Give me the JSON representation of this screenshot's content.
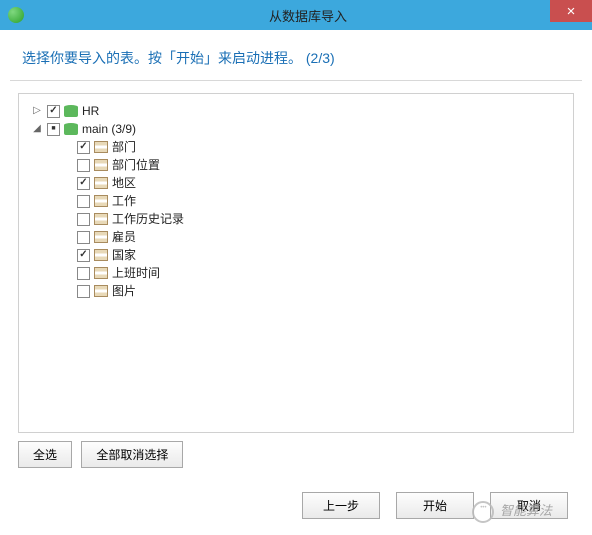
{
  "window": {
    "title": "从数据库导入",
    "close_char": "×"
  },
  "header": {
    "text": "选择你要导入的表。按「开始」来启动进程。 (2/3)"
  },
  "tree": {
    "nodes": [
      {
        "label": "HR",
        "type": "db",
        "checked": "checked",
        "expanded": false
      },
      {
        "label": "main (3/9)",
        "type": "db",
        "checked": "partial",
        "expanded": true,
        "children": [
          {
            "label": "部门",
            "checked": "checked"
          },
          {
            "label": "部门位置",
            "checked": "unchecked"
          },
          {
            "label": "地区",
            "checked": "checked"
          },
          {
            "label": "工作",
            "checked": "unchecked"
          },
          {
            "label": "工作历史记录",
            "checked": "unchecked"
          },
          {
            "label": "雇员",
            "checked": "unchecked"
          },
          {
            "label": "国家",
            "checked": "checked"
          },
          {
            "label": "上班时间",
            "checked": "unchecked"
          },
          {
            "label": "图片",
            "checked": "unchecked"
          }
        ]
      }
    ]
  },
  "buttons": {
    "select_all": "全选",
    "deselect_all": "全部取消选择",
    "prev": "上一步",
    "start": "开始",
    "cancel": "取消"
  },
  "watermark": "智能算法"
}
